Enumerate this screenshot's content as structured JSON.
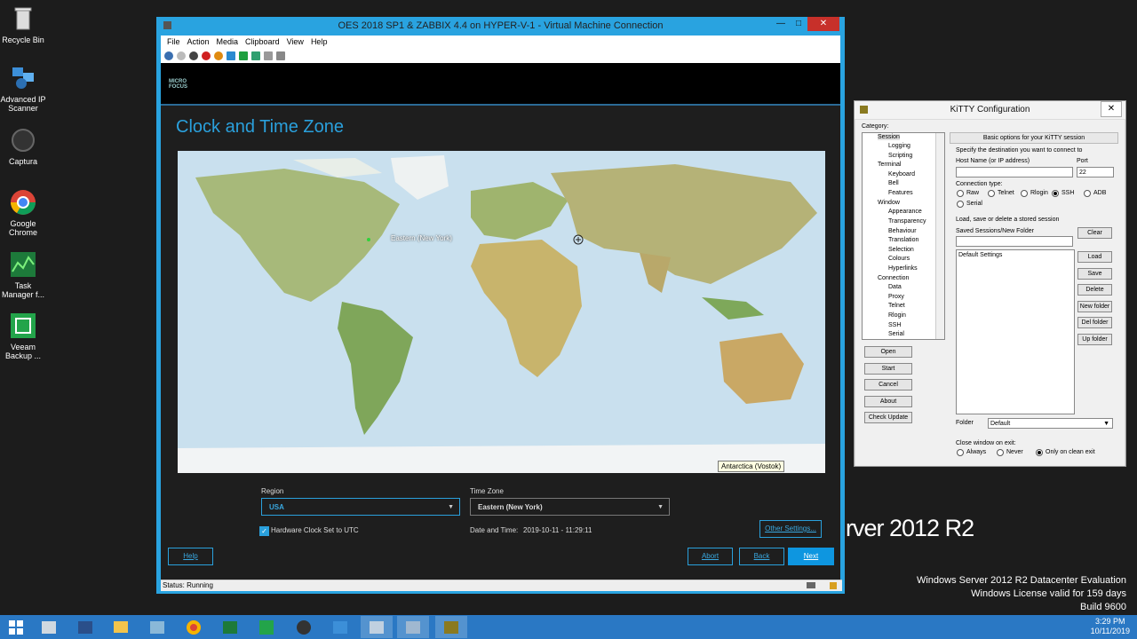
{
  "desktop": {
    "icons": [
      {
        "label": "Recycle Bin"
      },
      {
        "label": "Advanced IP Scanner"
      },
      {
        "label": "Captura"
      },
      {
        "label": "Google Chrome"
      },
      {
        "label": "Task Manager f..."
      },
      {
        "label": "Veeam Backup ..."
      }
    ],
    "server_text": "rver 2012 R2",
    "watermark": {
      "line1": "Windows Server 2012 R2 Datacenter Evaluation",
      "line2": "Windows License valid for 159 days",
      "line3": "Build 9600"
    }
  },
  "taskbar": {
    "time": "3:29 PM",
    "date": "10/11/2019"
  },
  "vm_window": {
    "title": "OES 2018 SP1 & ZABBIX 4.4 on HYPER-V-1 - Virtual Machine Connection",
    "menu": [
      "File",
      "Action",
      "Media",
      "Clipboard",
      "View",
      "Help"
    ],
    "status": "Status: Running",
    "guest": {
      "logo_line1": "MICRO",
      "logo_line2": "FOCUS",
      "page_title": "Clock and Time Zone",
      "map_selected_label": "Eastern (New York)",
      "map_tooltip": "Antarctica (Vostok)",
      "region_label": "Region",
      "region_value": "USA",
      "timezone_label": "Time Zone",
      "timezone_value": "Eastern (New York)",
      "hw_clock_label": "Hardware Clock Set to UTC",
      "datetime_label": "Date and Time:",
      "datetime_value": "2019-10-11 - 11:29:11",
      "other_settings": "Other Settings...",
      "help": "Help",
      "abort": "Abort",
      "back": "Back",
      "next": "Next"
    }
  },
  "kitty": {
    "title": "KiTTY Configuration",
    "category_label": "Category:",
    "tree": [
      {
        "label": "Session",
        "indent": 1
      },
      {
        "label": "Logging",
        "indent": 2
      },
      {
        "label": "Scripting",
        "indent": 2
      },
      {
        "label": "Terminal",
        "indent": 1
      },
      {
        "label": "Keyboard",
        "indent": 2
      },
      {
        "label": "Bell",
        "indent": 2
      },
      {
        "label": "Features",
        "indent": 2
      },
      {
        "label": "Window",
        "indent": 1
      },
      {
        "label": "Appearance",
        "indent": 2
      },
      {
        "label": "Transparency",
        "indent": 2
      },
      {
        "label": "Behaviour",
        "indent": 2
      },
      {
        "label": "Translation",
        "indent": 2
      },
      {
        "label": "Selection",
        "indent": 2
      },
      {
        "label": "Colours",
        "indent": 2
      },
      {
        "label": "Hyperlinks",
        "indent": 2
      },
      {
        "label": "Connection",
        "indent": 1
      },
      {
        "label": "Data",
        "indent": 2
      },
      {
        "label": "Proxy",
        "indent": 2
      },
      {
        "label": "Telnet",
        "indent": 2
      },
      {
        "label": "Rlogin",
        "indent": 2
      },
      {
        "label": "SSH",
        "indent": 2
      },
      {
        "label": "Serial",
        "indent": 2
      }
    ],
    "left_buttons": [
      "Open",
      "Start",
      "Cancel",
      "About",
      "Check Update"
    ],
    "header": "Basic options for your KiTTY session",
    "specify": "Specify the destination you want to connect to",
    "host_label": "Host Name (or IP address)",
    "port_label": "Port",
    "port_value": "22",
    "conn_type_label": "Connection type:",
    "conn_types": [
      "Raw",
      "Telnet",
      "Rlogin",
      "SSH",
      "ADB",
      "Serial"
    ],
    "conn_selected": "SSH",
    "load_save_label": "Load, save or delete a stored session",
    "saved_label": "Saved Sessions/New Folder",
    "sessions": [
      "Default Settings"
    ],
    "session_buttons": [
      "Clear",
      "Load",
      "Save",
      "Delete",
      "New folder",
      "Del folder",
      "Up folder"
    ],
    "folder_label": "Folder",
    "folder_value": "Default",
    "close_label": "Close window on exit:",
    "close_options": [
      "Always",
      "Never",
      "Only on clean exit"
    ],
    "close_selected": "Only on clean exit"
  }
}
